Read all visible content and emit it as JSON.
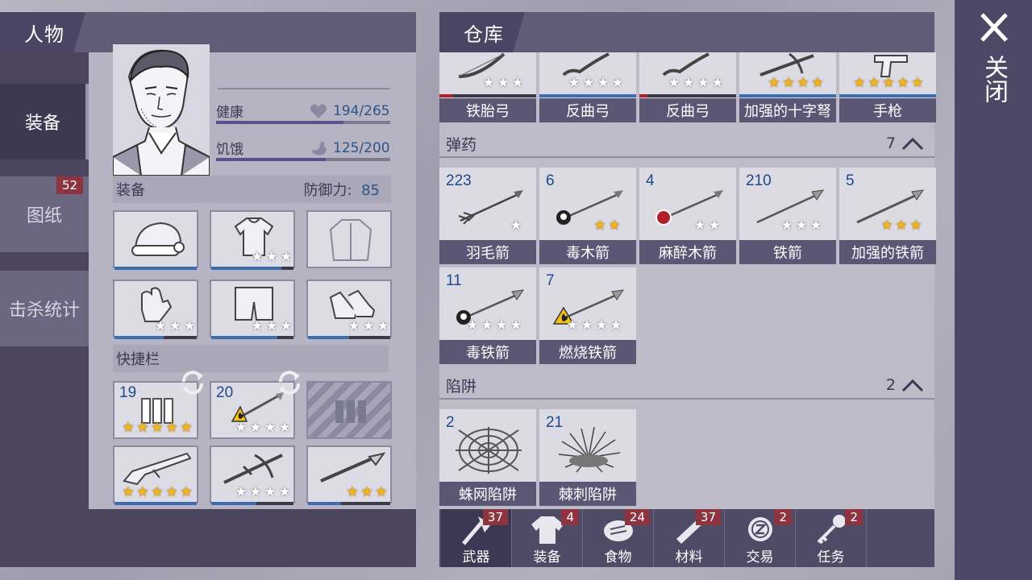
{
  "left": {
    "title": "人物",
    "tabs": [
      {
        "label": "装备"
      },
      {
        "label": "图纸",
        "badge": "52"
      },
      {
        "label": "击杀统计"
      }
    ],
    "stats": {
      "health_label": "健康",
      "health_value": "194/265",
      "health_fraction": 0.73,
      "hunger_label": "饥饿",
      "hunger_value": "125/200",
      "hunger_fraction": 0.63
    },
    "equipment": {
      "title": "装备",
      "defense_label": "防御力:",
      "defense_value": "85"
    },
    "quickbar": {
      "title": "快捷栏",
      "slot1_count": "19",
      "slot2_count": "20"
    }
  },
  "warehouse": {
    "title": "仓库",
    "top_items": [
      "铁胎弓",
      "反曲弓",
      "反曲弓",
      "加强的十字弩",
      "手枪"
    ],
    "ammo": {
      "label": "弹药",
      "count": "7",
      "items": [
        {
          "count": "223",
          "name": "羽毛箭"
        },
        {
          "count": "6",
          "name": "毒木箭"
        },
        {
          "count": "4",
          "name": "麻醉木箭"
        },
        {
          "count": "210",
          "name": "铁箭"
        },
        {
          "count": "5",
          "name": "加强的铁箭"
        },
        {
          "count": "11",
          "name": "毒铁箭"
        },
        {
          "count": "7",
          "name": "燃烧铁箭"
        }
      ]
    },
    "traps": {
      "label": "陷阱",
      "count": "2",
      "items": [
        {
          "count": "2",
          "name": "蛛网陷阱"
        },
        {
          "count": "21",
          "name": "棘刺陷阱"
        }
      ]
    },
    "bottom_tabs": [
      {
        "label": "武器",
        "badge": "37",
        "icon": "axe-icon"
      },
      {
        "label": "装备",
        "badge": "4",
        "icon": "shirt-icon"
      },
      {
        "label": "食物",
        "badge": "24",
        "icon": "meat-icon"
      },
      {
        "label": "材料",
        "badge": "37",
        "icon": "log-icon"
      },
      {
        "label": "交易",
        "badge": "2",
        "icon": "coin-icon"
      },
      {
        "label": "任务",
        "badge": "2",
        "icon": "key-icon"
      }
    ]
  },
  "close": {
    "icon": "close-icon",
    "label": "关闭"
  },
  "colors": {
    "accent_blue": "#3c6db0",
    "badge_red": "#8e3340",
    "star_gold": "#f2b51c"
  }
}
